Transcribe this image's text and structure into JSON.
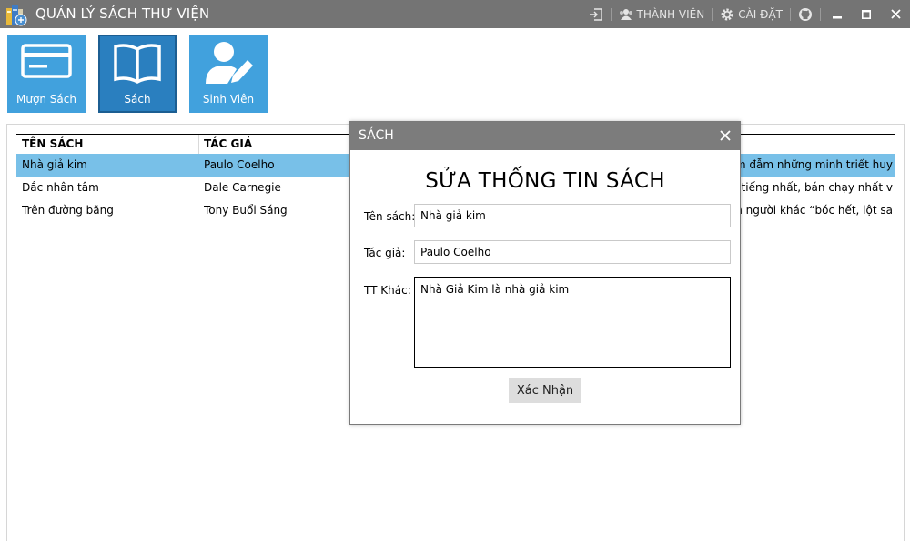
{
  "window": {
    "title": "QUẢN LÝ SÁCH THƯ VIỆN",
    "titlebar_color": "#747474",
    "buttons": {
      "members_label": "THÀNH VIÊN",
      "settings_label": "CÀI ĐẶT"
    }
  },
  "ribbon": {
    "tile_color": "#41a1dd",
    "active_tile_color": "#2a7fbf",
    "tiles": [
      {
        "label": "Mượn Sách",
        "icon": "card-icon",
        "active": false
      },
      {
        "label": "Sách",
        "icon": "open-book-icon",
        "active": true
      },
      {
        "label": "Sinh Viên",
        "icon": "user-edit-icon",
        "active": false
      }
    ]
  },
  "table": {
    "columns": [
      "TÊN SÁCH",
      "TÁC GIẢ"
    ],
    "selected_row_color": "#78c0e8",
    "rows": [
      {
        "title": "Nhà giả kim",
        "author": "Paulo Coelho",
        "info": "hấm đẫm những minh triết huy",
        "selected": true
      },
      {
        "title": "Đắc nhân tâm",
        "author": "Dale Carnegie",
        "info": "nổi tiếng nhất, bán chạy nhất v",
        "selected": false
      },
      {
        "title": "Trên đường băng",
        "author": "Tony Buổi Sáng",
        "info": "o xin người khác “bóc hết, lột sa",
        "selected": false
      }
    ]
  },
  "dialog": {
    "title": "SÁCH",
    "heading": "SỬA THỐNG TIN SÁCH",
    "fields": {
      "title_label": "Tên sách:",
      "title_value": "Nhà giả kim",
      "author_label": "Tác giả:",
      "author_value": "Paulo Coelho",
      "other_label": "TT Khác:",
      "other_value": "Nhà Giả Kim là nhà giả kim"
    },
    "confirm_label": "Xác Nhận"
  }
}
